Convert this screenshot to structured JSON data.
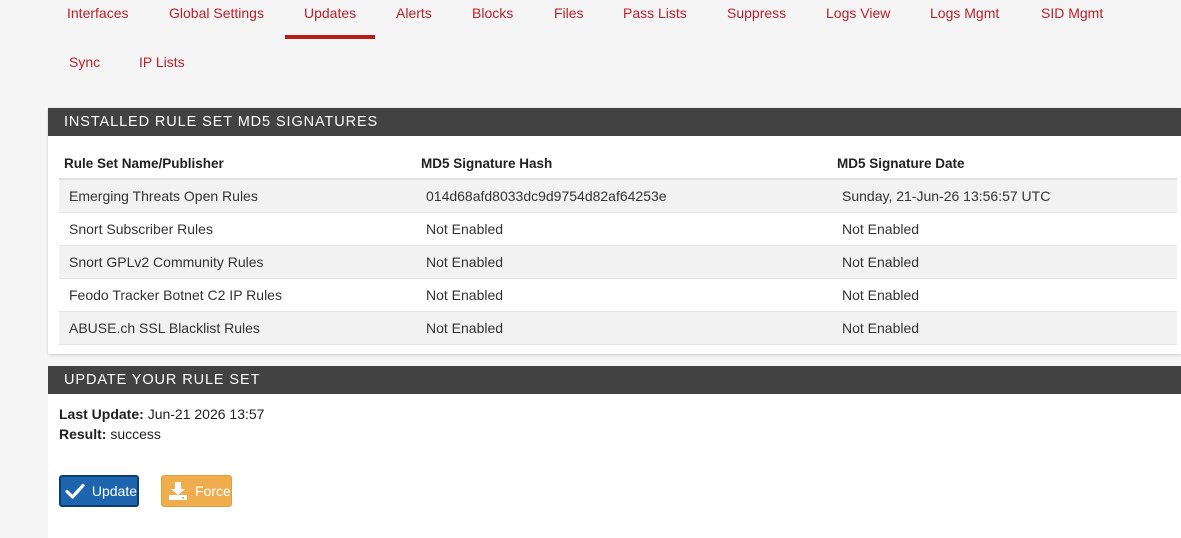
{
  "nav": {
    "tabs": [
      {
        "label": "Interfaces"
      },
      {
        "label": "Global Settings"
      },
      {
        "label": "Updates",
        "active": true
      },
      {
        "label": "Alerts"
      },
      {
        "label": "Blocks"
      },
      {
        "label": "Files"
      },
      {
        "label": "Pass Lists"
      },
      {
        "label": "Suppress"
      },
      {
        "label": "Logs View"
      },
      {
        "label": "Logs Mgmt"
      },
      {
        "label": "SID Mgmt"
      },
      {
        "label": "Sync"
      },
      {
        "label": "IP Lists"
      }
    ]
  },
  "md5_panel": {
    "heading": "INSTALLED RULE SET MD5 SIGNATURES",
    "columns": [
      "Rule Set Name/Publisher",
      "MD5 Signature Hash",
      "MD5 Signature Date"
    ],
    "rows": [
      [
        "Emerging Threats Open Rules",
        "014d68afd8033dc9d9754d82af64253e",
        "Sunday, 21-Jun-26 13:56:57 UTC"
      ],
      [
        "Snort Subscriber Rules",
        "Not Enabled",
        "Not Enabled"
      ],
      [
        "Snort GPLv2 Community Rules",
        "Not Enabled",
        "Not Enabled"
      ],
      [
        "Feodo Tracker Botnet C2 IP Rules",
        "Not Enabled",
        "Not Enabled"
      ],
      [
        "ABUSE.ch SSL Blacklist Rules",
        "Not Enabled",
        "Not Enabled"
      ]
    ]
  },
  "update_panel": {
    "heading": "UPDATE YOUR RULE SET",
    "last_update_label": "Last Update:",
    "last_update_value": "Jun-21 2026 13:57",
    "result_label": "Result:",
    "result_value": "success",
    "update_button": {
      "label": "Update",
      "icon": "check-icon"
    },
    "force_button": {
      "label": "Force",
      "icon": "download-icon"
    }
  },
  "colors": {
    "tab_text": "#c0202a",
    "active_underline": "#b71c1c",
    "panel_heading_bg": "#424242",
    "update_button_bg": "#1e65b0",
    "force_button_bg": "#f0ad4e"
  }
}
